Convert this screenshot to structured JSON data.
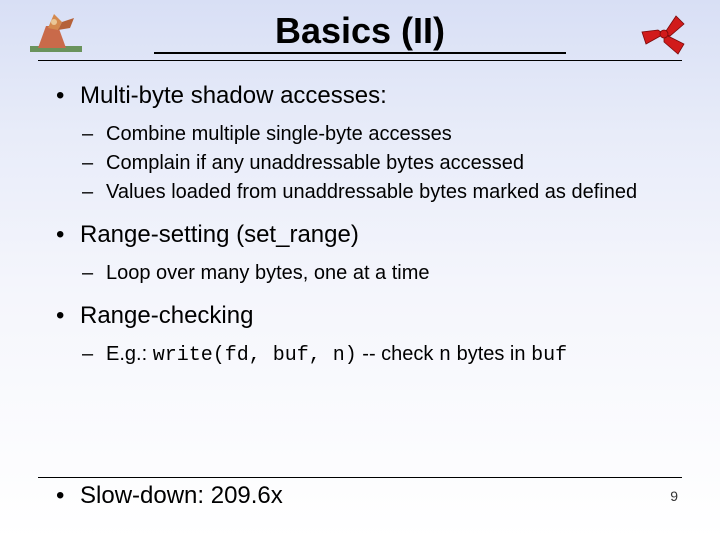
{
  "title": "Basics (II)",
  "bullets": {
    "b1": {
      "text": "Multi-byte shadow accesses:",
      "sub": {
        "s1": "Combine multiple single-byte accesses",
        "s2": "Complain if any unaddressable bytes accessed",
        "s3": "Values loaded from unaddressable bytes marked as defined"
      }
    },
    "b2": {
      "text": "Range-setting (set_range)",
      "sub": {
        "s1": "Loop over many bytes, one at a time"
      }
    },
    "b3": {
      "text": "Range-checking",
      "sub": {
        "s1_pre": "E.g.: ",
        "s1_code1": "write(fd, buf, n)",
        "s1_mid": " -- check ",
        "s1_code2": "n",
        "s1_mid2": " bytes in ",
        "s1_code3": "buf"
      }
    }
  },
  "footer": {
    "slowdown": "Slow-down: 209.6x",
    "page": "9"
  },
  "decor": {
    "left_icon": "knight-figure",
    "right_icon": "triskelion-emblem"
  }
}
